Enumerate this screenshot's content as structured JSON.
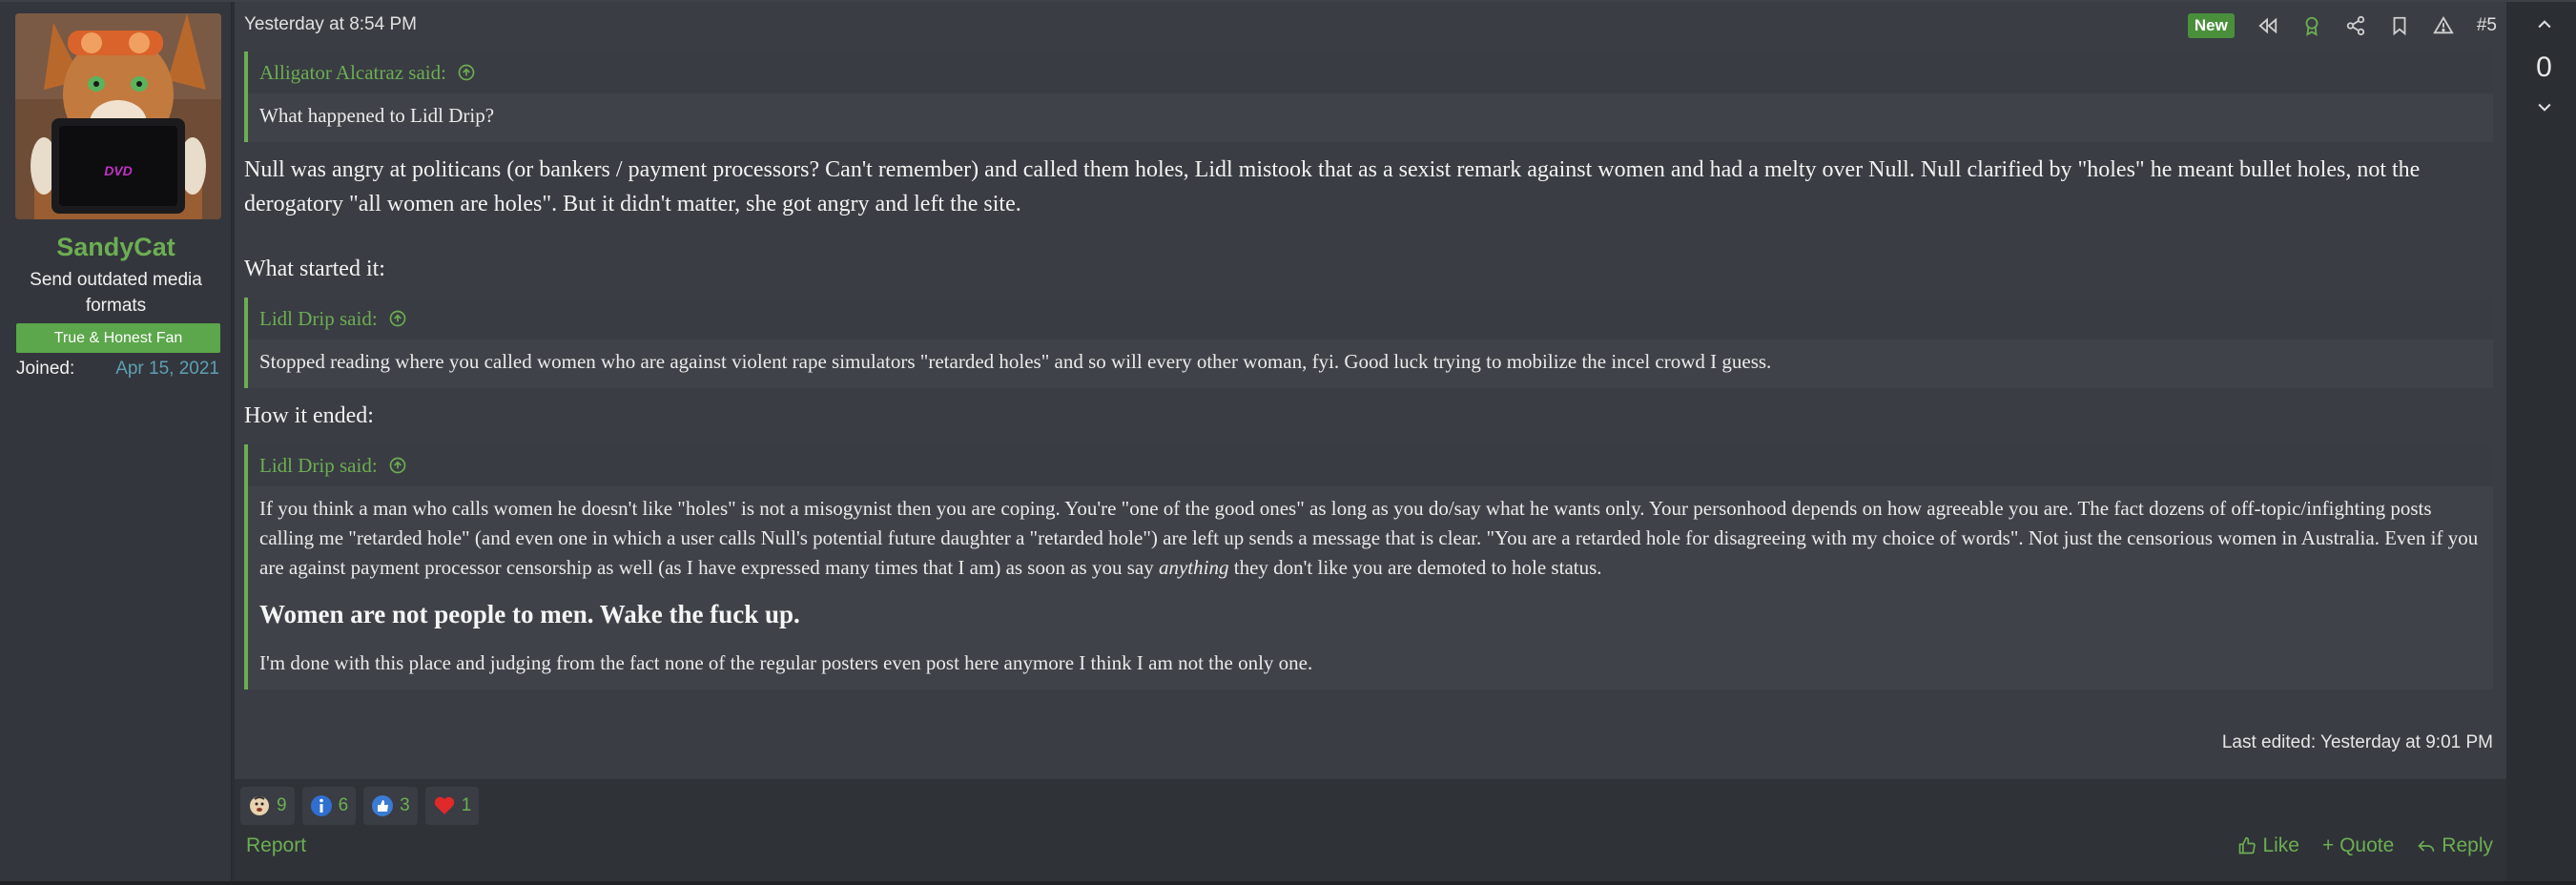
{
  "user": {
    "name": "SandyCat",
    "title": "Send outdated media formats",
    "banner": "True & Honest Fan",
    "joined_label": "Joined:",
    "joined_date": "Apr 15, 2021",
    "avatar_caption": "DVD"
  },
  "post": {
    "date": "Yesterday at 8:54 PM",
    "new_badge": "New",
    "number": "#5",
    "quote1": {
      "author": "Alligator Alcatraz said:",
      "text": "What happened to Lidl Drip?"
    },
    "paragraph1": "Null was angry at politicans (or bankers / payment processors? Can't remember) and called them holes, Lidl mistook that as a sexist remark against women and had a melty over Null. Null clarified by \"holes\" he meant bullet holes, not the derogatory \"all women are holes\". But it didn't matter, she got angry and left the site.",
    "heading_started": "What started it:",
    "quote2": {
      "author": "Lidl Drip said:",
      "text": "Stopped reading where you called women who are against violent rape simulators \"retarded holes\" and so will every other woman, fyi. Good luck trying to mobilize the incel crowd I guess."
    },
    "heading_ended": "How it ended:",
    "quote3": {
      "author": "Lidl Drip said:",
      "text_before_italic": "If you think a man who calls women he doesn't like \"holes\" is not a misogynist then you are coping. You're \"one of the good ones\" as long as you do/say what he wants only. Your personhood depends on how agreeable you are. The fact dozens of off-topic/infighting posts calling me \"retarded hole\" (and even one in which a user calls Null's potential future daughter a \"retarded hole\") are left up sends a message that is clear. \"You are a retarded hole for disagreeing with my choice of words\". Not just the censorious women in Australia. Even if you are against payment processor censorship as well (as I have expressed many times that I am) as soon as you say ",
      "italic_word": "anything",
      "text_after_italic": " they don't like you are demoted to hole status.",
      "bold_line": "Women are not people to men. Wake the fuck up.",
      "closing": "I'm done with this place and judging from the fact none of the regular posters even post here anymore I think I am not the only one."
    },
    "last_edited": "Last edited: Yesterday at 9:01 PM"
  },
  "reactions": [
    {
      "icon": "face-emoji-icon",
      "count": "9"
    },
    {
      "icon": "informative-icon",
      "count": "6"
    },
    {
      "icon": "thumbs-up-icon",
      "count": "3"
    },
    {
      "icon": "heart-icon",
      "count": "1"
    }
  ],
  "footer": {
    "report": "Report",
    "like": "Like",
    "quote": "+ Quote",
    "reply": "Reply"
  },
  "votes": {
    "count": "0"
  },
  "colors": {
    "accent_green": "#6cae53",
    "banner_green": "#5ca64b",
    "link_blue": "#5ea0b5",
    "panel": "#3a3d43",
    "background": "#2b2e33"
  }
}
